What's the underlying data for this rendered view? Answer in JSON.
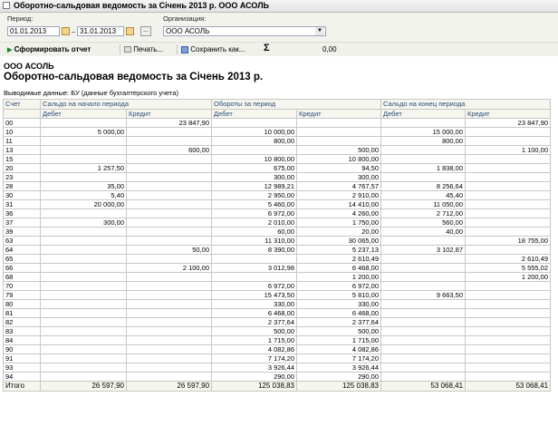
{
  "window": {
    "title": "Оборотно-сальдовая ведомость за Січень 2013 р. ООО АСОЛЬ"
  },
  "params": {
    "period_label": "Период:",
    "date_from": "01.01.2013",
    "date_to": "31.01.2013",
    "dash": "–",
    "more_label": "...",
    "org_label": "Организация:",
    "org_value": "ООО АСОЛЬ"
  },
  "toolbar": {
    "generate_label": "Сформировать отчет",
    "print_label": "Печать...",
    "save_label": "Сохранить как...",
    "sum_symbol": "Σ",
    "sum_value": "0,00"
  },
  "report": {
    "org": "ООО АСОЛЬ",
    "title": "Оборотно-сальдовая ведомость за Січень 2013 р.",
    "subtitle": "Выводимые данные:  БУ (данные бухгалтерского учета)",
    "header": {
      "account": "Счет",
      "opening": "Сальдо на начало периода",
      "turnover": "Обороты за период",
      "closing": "Сальдо на конец периода",
      "debit": "Дебет",
      "credit": "Кредит"
    },
    "rows": [
      [
        "00",
        "",
        "23 847,90",
        "",
        "",
        "",
        "23 847,90"
      ],
      [
        "10",
        "5 000,00",
        "",
        "10 000,00",
        "",
        "15 000,00",
        ""
      ],
      [
        "11",
        "",
        "",
        "800,00",
        "",
        "800,00",
        ""
      ],
      [
        "13",
        "",
        "600,00",
        "",
        "500,00",
        "",
        "1 100,00"
      ],
      [
        "15",
        "",
        "",
        "10 800,00",
        "10 800,00",
        "",
        ""
      ],
      [
        "20",
        "1 257,50",
        "",
        "675,00",
        "94,50",
        "1 838,00",
        ""
      ],
      [
        "23",
        "",
        "",
        "300,00",
        "300,00",
        "",
        ""
      ],
      [
        "28",
        "35,00",
        "",
        "12 989,21",
        "4 767,57",
        "8 256,64",
        ""
      ],
      [
        "30",
        "5,40",
        "",
        "2 950,00",
        "2 910,00",
        "45,40",
        ""
      ],
      [
        "31",
        "20 000,00",
        "",
        "5 460,00",
        "14 410,00",
        "11 050,00",
        ""
      ],
      [
        "36",
        "",
        "",
        "6 972,00",
        "4 260,00",
        "2 712,00",
        ""
      ],
      [
        "37",
        "300,00",
        "",
        "2 010,00",
        "1 750,00",
        "560,00",
        ""
      ],
      [
        "39",
        "",
        "",
        "60,00",
        "20,00",
        "40,00",
        ""
      ],
      [
        "63",
        "",
        "",
        "11 310,00",
        "30 065,00",
        "",
        "18 755,00"
      ],
      [
        "64",
        "",
        "50,00",
        "8 390,00",
        "5 237,13",
        "3 102,87",
        ""
      ],
      [
        "65",
        "",
        "",
        "",
        "2 610,49",
        "",
        "2 610,49"
      ],
      [
        "66",
        "",
        "2 100,00",
        "3 012,98",
        "6 468,00",
        "",
        "5 555,02"
      ],
      [
        "68",
        "",
        "",
        "",
        "1 200,00",
        "",
        "1 200,00"
      ],
      [
        "70",
        "",
        "",
        "6 972,00",
        "6 972,00",
        "",
        ""
      ],
      [
        "79",
        "",
        "",
        "15 473,50",
        "5 810,00",
        "9 663,50",
        ""
      ],
      [
        "80",
        "",
        "",
        "330,00",
        "330,00",
        "",
        ""
      ],
      [
        "81",
        "",
        "",
        "6 468,00",
        "6 468,00",
        "",
        ""
      ],
      [
        "82",
        "",
        "",
        "2 377,64",
        "2 377,64",
        "",
        ""
      ],
      [
        "83",
        "",
        "",
        "500,00",
        "500,00",
        "",
        ""
      ],
      [
        "84",
        "",
        "",
        "1 715,00",
        "1 715,00",
        "",
        ""
      ],
      [
        "90",
        "",
        "",
        "4 082,86",
        "4 082,86",
        "",
        ""
      ],
      [
        "91",
        "",
        "",
        "7 174,20",
        "7 174,20",
        "",
        ""
      ],
      [
        "93",
        "",
        "",
        "3 926,44",
        "3 926,44",
        "",
        ""
      ],
      [
        "94",
        "",
        "",
        "290,00",
        "290,00",
        "",
        ""
      ]
    ],
    "total": [
      "Итого",
      "26 597,90",
      "26 597,90",
      "125 038,83",
      "125 038,83",
      "53 068,41",
      "53 068,41"
    ]
  }
}
